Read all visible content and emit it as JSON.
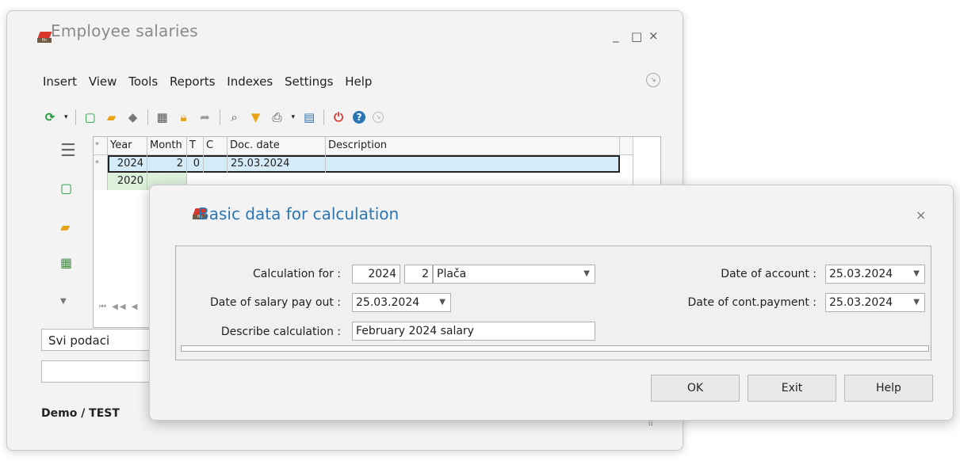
{
  "main_window": {
    "title": "Employee salaries",
    "minimize": "_",
    "maximize": "□",
    "close": "×",
    "menu": [
      "Insert",
      "View",
      "Tools",
      "Reports",
      "Indexes",
      "Settings",
      "Help"
    ],
    "grid": {
      "columns": [
        "*",
        "Year",
        "Month",
        "T",
        "C",
        "Doc. date",
        "Description"
      ],
      "rows": [
        {
          "marker": "*",
          "year": "2024",
          "month": "2",
          "t": "0",
          "c": "",
          "doc_date": "25.03.2024",
          "description": ""
        },
        {
          "marker": "",
          "year": "2020",
          "month": "",
          "t": "",
          "c": "",
          "doc_date": "",
          "description": ""
        }
      ],
      "nav": "⏮ ◀◀ ◀"
    },
    "filter_value": "Svi podaci",
    "status": "Demo / TEST"
  },
  "dialog": {
    "title": "Basic data for calculation",
    "close": "×",
    "calculation_for_label": "Calculation for :",
    "calc_year": "2024",
    "calc_month": "2",
    "calc_type": "Plača",
    "payout_label": "Date of salary pay out :",
    "payout_date": "25.03.2024",
    "describe_label": "Describe calculation :",
    "describe_value": "February 2024 salary",
    "account_label": "Date of account :",
    "account_date": "25.03.2024",
    "contpay_label": "Date of cont.payment :",
    "contpay_date": "25.03.2024",
    "ok": "OK",
    "exit": "Exit",
    "help": "Help"
  },
  "colors": {
    "dialog_title": "#2a76b5",
    "selected_row": "#d4ecf7",
    "second_row": "#dcf0dc"
  }
}
